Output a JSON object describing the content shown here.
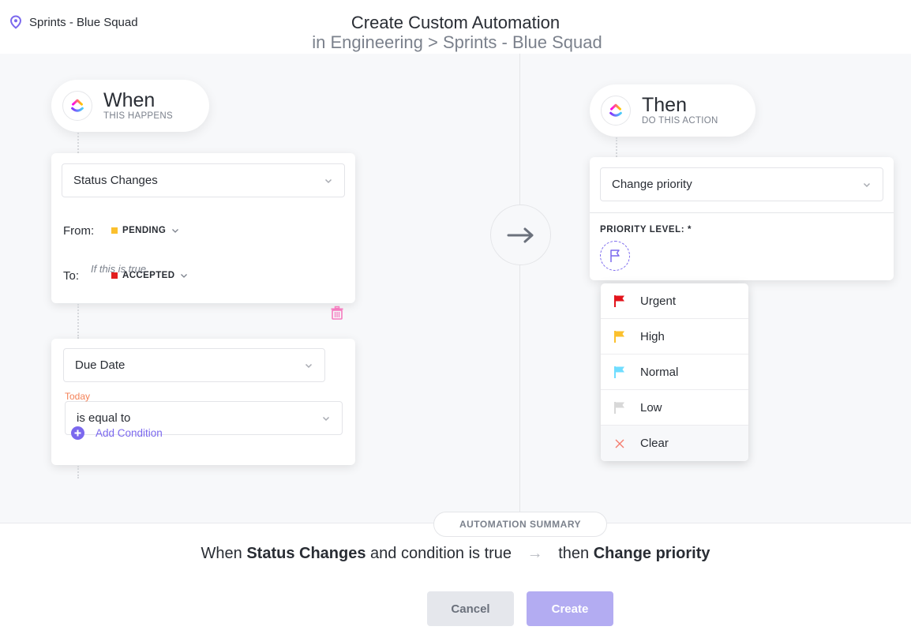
{
  "header": {
    "location": "Sprints - Blue Squad",
    "title": "Create Custom Automation",
    "subtitle": "in Engineering > Sprints - Blue Squad"
  },
  "when": {
    "title": "When",
    "caption": "THIS HAPPENS",
    "trigger": "Status Changes",
    "from_label": "From:",
    "from_status": {
      "name": "PENDING",
      "color": "#fbc02d"
    },
    "to_label": "To:",
    "to_status": {
      "name": "ACCEPTED",
      "color": "#e21f1f"
    },
    "condition_caption": "If this is true",
    "condition": {
      "field": "Due Date",
      "operator": "is equal to",
      "value": "Today"
    },
    "add_condition": "Add Condition"
  },
  "then": {
    "title": "Then",
    "caption": "DO THIS ACTION",
    "action": "Change priority",
    "priority_label": "PRIORITY LEVEL: *",
    "priority_options": [
      {
        "label": "Urgent",
        "icon": "flag-icon",
        "color": "#e2141c"
      },
      {
        "label": "High",
        "icon": "flag-icon",
        "color": "#fbc02d"
      },
      {
        "label": "Normal",
        "icon": "flag-icon",
        "color": "#6fddff"
      },
      {
        "label": "Low",
        "icon": "flag-icon",
        "color": "#d8d8d8"
      },
      {
        "label": "Clear",
        "icon": "close-icon",
        "color": "#f47c6e"
      }
    ]
  },
  "summary": {
    "label": "AUTOMATION SUMMARY",
    "when_prefix": "When",
    "trigger": "Status Changes",
    "middle": "and condition is true",
    "arrow": "→",
    "then_prefix": "then",
    "action": "Change priority"
  },
  "buttons": {
    "cancel": "Cancel",
    "create": "Create"
  },
  "colors": {
    "accent": "#7b68ee",
    "create_disabled": "#b3acf2",
    "today": "#f48258",
    "trash": "#f57bbf"
  }
}
